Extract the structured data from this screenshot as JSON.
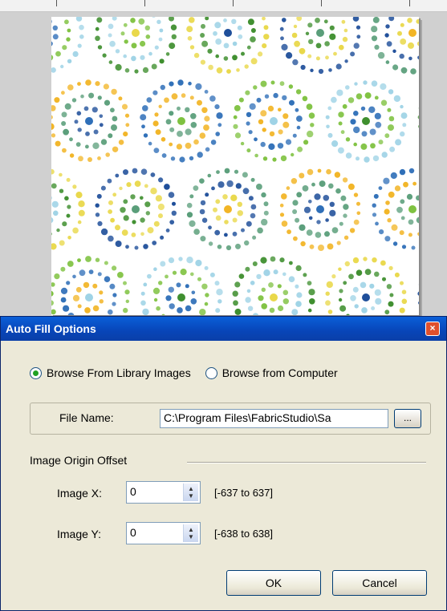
{
  "dialog": {
    "title": "Auto Fill Options",
    "close_glyph": "×",
    "radio_library_label": "Browse From Library Images",
    "radio_computer_label": "Browse from Computer",
    "selected_radio": "library",
    "file_name_label": "File Name:",
    "file_name_value": "C:\\Program Files\\FabricStudio\\Sa",
    "browse_button_label": "...",
    "offset_group_label": "Image Origin Offset",
    "image_x_label": "Image X:",
    "image_x_value": "0",
    "image_x_range": "[-637 to 637]",
    "image_y_label": "Image Y:",
    "image_y_value": "0",
    "image_y_range": "[-638 to 638]",
    "ok_label": "OK",
    "cancel_label": "Cancel"
  },
  "fabric_colors": [
    "#f2b526",
    "#2f6fb8",
    "#7fc241",
    "#9fd3e6",
    "#3f8f2f",
    "#e9d84a",
    "#1f4f9a",
    "#5a9e7a"
  ]
}
